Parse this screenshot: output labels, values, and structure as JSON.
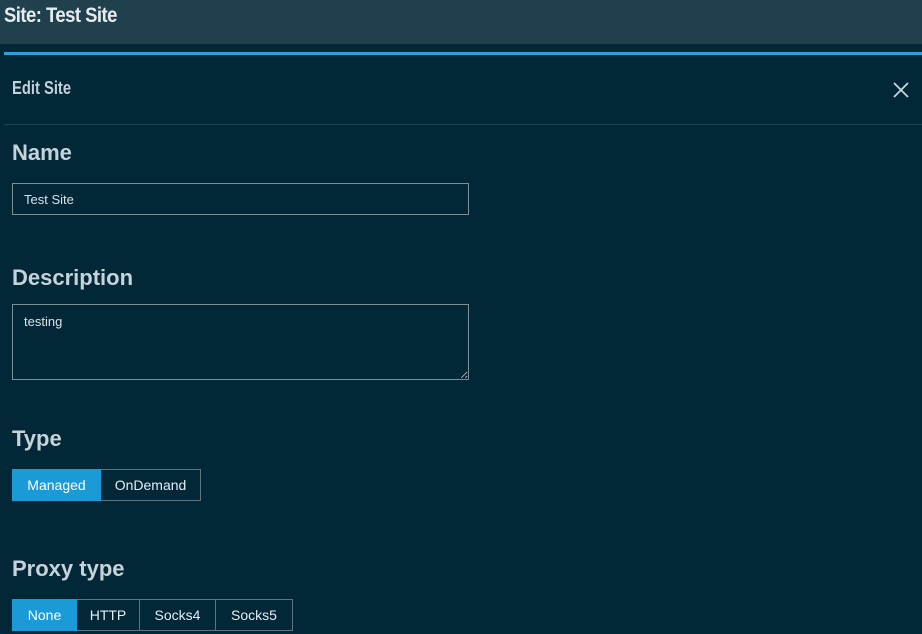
{
  "header": {
    "title": "Site: Test Site"
  },
  "modal": {
    "title": "Edit Site",
    "name": {
      "label": "Name",
      "value": "Test Site"
    },
    "description": {
      "label": "Description",
      "value": "testing"
    },
    "type": {
      "label": "Type",
      "options": [
        "Managed",
        "OnDemand"
      ],
      "selected": "Managed"
    },
    "proxy_type": {
      "label": "Proxy type",
      "options": [
        "None",
        "HTTP",
        "Socks4",
        "Socks5"
      ],
      "selected": "None"
    }
  },
  "colors": {
    "background": "#022838",
    "topbar": "#20404e",
    "accent": "#1a9ad6"
  }
}
